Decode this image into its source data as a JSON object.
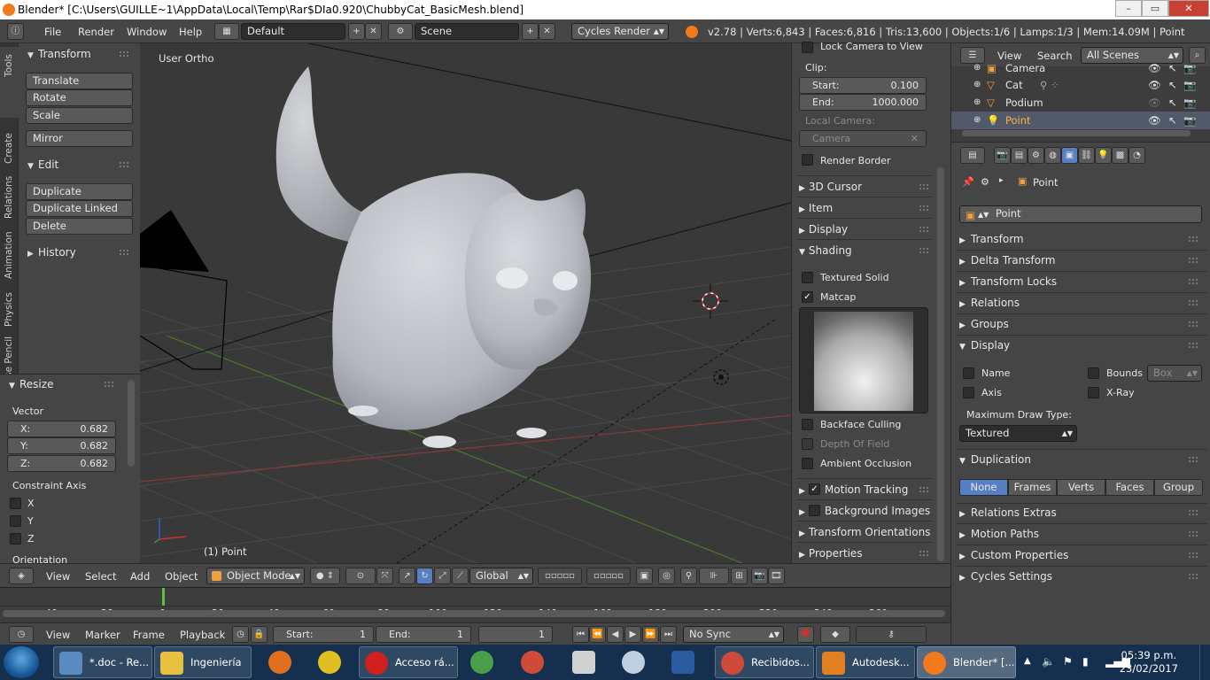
{
  "window": {
    "title": "Blender* [C:\\Users\\GUILLE~1\\AppData\\Local\\Temp\\Rar$DIa0.920\\ChubbyCat_BasicMesh.blend]",
    "minimize": "–",
    "maximize": "▭",
    "close": "✕"
  },
  "info": {
    "menus": [
      "File",
      "Render",
      "Window",
      "Help"
    ],
    "layout": "Default",
    "scene": "Scene",
    "engine": "Cycles Render",
    "stats": "v2.78 | Verts:6,843 | Faces:6,816 | Tris:13,600 | Objects:1/6 | Lamps:1/3 | Mem:14.09M | Point"
  },
  "tool_tabs": [
    "Tools",
    "Create",
    "Relations",
    "Animation",
    "Physics",
    "Grease Pencil"
  ],
  "toolshelf": {
    "transform": {
      "title": "Transform",
      "buttons": [
        "Translate",
        "Rotate",
        "Scale",
        "Mirror"
      ]
    },
    "edit": {
      "title": "Edit",
      "buttons": [
        "Duplicate",
        "Duplicate Linked",
        "Delete"
      ]
    },
    "history": {
      "title": "History"
    }
  },
  "redo": {
    "title": "Resize",
    "vector_label": "Vector",
    "x": {
      "label": "X:",
      "value": "0.682"
    },
    "y": {
      "label": "Y:",
      "value": "0.682"
    },
    "z": {
      "label": "Z:",
      "value": "0.682"
    },
    "constraint_label": "Constraint Axis",
    "axes": [
      "X",
      "Y",
      "Z"
    ],
    "orientation_label": "Orientation"
  },
  "viewport": {
    "view_name": "User Ortho",
    "object_label": "(1) Point"
  },
  "npanel": {
    "lock_camera": "Lock Camera to View",
    "clip": "Clip:",
    "start": {
      "label": "Start:",
      "value": "0.100"
    },
    "end": {
      "label": "End:",
      "value": "1000.000"
    },
    "local_camera": "Local Camera:",
    "camera_field": "Camera",
    "render_border": "Render Border",
    "sections": [
      "3D Cursor",
      "Item",
      "Display"
    ],
    "shading": "Shading",
    "textured_solid": "Textured Solid",
    "matcap": "Matcap",
    "backface": "Backface Culling",
    "dof": "Depth Of Field",
    "ao": "Ambient Occlusion",
    "motion_tracking": "Motion Tracking",
    "background_images": "Background Images",
    "transform_orientations": "Transform Orientations",
    "properties": "Properties"
  },
  "view3d_header": {
    "menus": [
      "View",
      "Select",
      "Add",
      "Object"
    ],
    "mode": "Object Mode",
    "orientation": "Global"
  },
  "timeline": {
    "ticks": [
      "-40",
      "-20",
      "0",
      "20",
      "40",
      "60",
      "80",
      "100",
      "120",
      "140",
      "160",
      "180",
      "200",
      "220",
      "240",
      "260"
    ],
    "menus": [
      "View",
      "Marker",
      "Frame",
      "Playback"
    ],
    "start": {
      "label": "Start:",
      "value": "1"
    },
    "end": {
      "label": "End:",
      "value": "1"
    },
    "current": "1",
    "sync": "No Sync"
  },
  "outliner": {
    "menus": [
      "View",
      "Search"
    ],
    "filter": "All Scenes",
    "rows": [
      "Camera",
      "Cat",
      "Podium",
      "Point"
    ]
  },
  "properties": {
    "breadcrumb": "Point",
    "name": "Point",
    "sections": [
      "Transform",
      "Delta Transform",
      "Transform Locks",
      "Relations",
      "Groups"
    ],
    "display": "Display",
    "name_chk": "Name",
    "bounds_chk": "Bounds",
    "bounds_type": "Box",
    "axis_chk": "Axis",
    "xray_chk": "X-Ray",
    "max_draw_label": "Maximum Draw Type:",
    "max_draw": "Textured",
    "duplication": "Duplication",
    "dup_options": [
      "None",
      "Frames",
      "Verts",
      "Faces",
      "Group"
    ],
    "sections2": [
      "Relations Extras",
      "Motion Paths",
      "Custom Properties",
      "Cycles Settings"
    ]
  },
  "taskbar": {
    "items": [
      "*.doc - Re...",
      "Ingeniería",
      "Acceso rá...",
      "Recibidos...",
      "Autodesk...",
      "Blender* [..."
    ],
    "time": "05:39 p.m.",
    "date": "23/02/2017"
  },
  "colors": {
    "accent": "#5680c2",
    "blender_orange": "#f07a1c",
    "taskbar": "#14304e"
  }
}
